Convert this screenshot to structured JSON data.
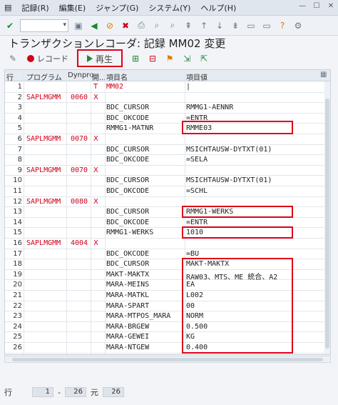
{
  "menu": {
    "items": [
      "記録(R)",
      "編集(E)",
      "ジャンプ(G)",
      "システム(Y)",
      "ヘルプ(H)"
    ]
  },
  "title": "トランザクションレコーダ: 記録 MM02 変更",
  "app_toolbar": {
    "record_label": "レコード",
    "play_label": "再生"
  },
  "grid": {
    "headers": {
      "row": "行",
      "program": "プログラム",
      "dynpro": "Dynpro",
      "start": "開...",
      "field": "項目名",
      "value": "項目値"
    },
    "rows": [
      {
        "no": "1",
        "program": "",
        "dynpro": "",
        "start": "T",
        "field": "MM02",
        "value": "|",
        "field_red": true
      },
      {
        "no": "2",
        "program": "SAPLMGMM",
        "dynpro": "0060",
        "start": "X",
        "field": "",
        "value": ""
      },
      {
        "no": "3",
        "program": "",
        "dynpro": "",
        "start": "",
        "field": "BDC_CURSOR",
        "value": "RMMG1-AENNR"
      },
      {
        "no": "4",
        "program": "",
        "dynpro": "",
        "start": "",
        "field": "BDC_OKCODE",
        "value": "=ENTR"
      },
      {
        "no": "5",
        "program": "",
        "dynpro": "",
        "start": "",
        "field": "RMMG1-MATNR",
        "value": "RMME03"
      },
      {
        "no": "6",
        "program": "SAPLMGMM",
        "dynpro": "0070",
        "start": "X",
        "field": "",
        "value": ""
      },
      {
        "no": "7",
        "program": "",
        "dynpro": "",
        "start": "",
        "field": "BDC_CURSOR",
        "value": "MSICHTAUSW-DYTXT(01)"
      },
      {
        "no": "8",
        "program": "",
        "dynpro": "",
        "start": "",
        "field": "BDC_OKCODE",
        "value": "=SELA"
      },
      {
        "no": "9",
        "program": "SAPLMGMM",
        "dynpro": "0070",
        "start": "X",
        "field": "",
        "value": ""
      },
      {
        "no": "10",
        "program": "",
        "dynpro": "",
        "start": "",
        "field": "BDC_CURSOR",
        "value": "MSICHTAUSW-DYTXT(01)"
      },
      {
        "no": "11",
        "program": "",
        "dynpro": "",
        "start": "",
        "field": "BDC_OKCODE",
        "value": "=SCHL"
      },
      {
        "no": "12",
        "program": "SAPLMGMM",
        "dynpro": "0080",
        "start": "X",
        "field": "",
        "value": ""
      },
      {
        "no": "13",
        "program": "",
        "dynpro": "",
        "start": "",
        "field": "BDC_CURSOR",
        "value": "RMMG1-WERKS"
      },
      {
        "no": "14",
        "program": "",
        "dynpro": "",
        "start": "",
        "field": "BDC_OKCODE",
        "value": "=ENTR"
      },
      {
        "no": "15",
        "program": "",
        "dynpro": "",
        "start": "",
        "field": "RMMG1-WERKS",
        "value": "1010"
      },
      {
        "no": "16",
        "program": "SAPLMGMM",
        "dynpro": "4004",
        "start": "X",
        "field": "",
        "value": ""
      },
      {
        "no": "17",
        "program": "",
        "dynpro": "",
        "start": "",
        "field": "BDC_OKCODE",
        "value": "=BU"
      },
      {
        "no": "18",
        "program": "",
        "dynpro": "",
        "start": "",
        "field": "BDC_CURSOR",
        "value": "MAKT-MAKTX"
      },
      {
        "no": "19",
        "program": "",
        "dynpro": "",
        "start": "",
        "field": "MAKT-MAKTX",
        "value": "RAW03、MTS、ME 統合、A2"
      },
      {
        "no": "20",
        "program": "",
        "dynpro": "",
        "start": "",
        "field": "MARA-MEINS",
        "value": "EA"
      },
      {
        "no": "21",
        "program": "",
        "dynpro": "",
        "start": "",
        "field": "MARA-MATKL",
        "value": "L002"
      },
      {
        "no": "22",
        "program": "",
        "dynpro": "",
        "start": "",
        "field": "MARA-SPART",
        "value": "00"
      },
      {
        "no": "23",
        "program": "",
        "dynpro": "",
        "start": "",
        "field": "MARA-MTPOS_MARA",
        "value": "NORM"
      },
      {
        "no": "24",
        "program": "",
        "dynpro": "",
        "start": "",
        "field": "MARA-BRGEW",
        "value": "0.500"
      },
      {
        "no": "25",
        "program": "",
        "dynpro": "",
        "start": "",
        "field": "MARA-GEWEI",
        "value": "KG"
      },
      {
        "no": "26",
        "program": "",
        "dynpro": "",
        "start": "",
        "field": "MARA-NTGEW",
        "value": "0.400"
      }
    ]
  },
  "footer": {
    "row_label": "行",
    "from": "1",
    "sep": "-",
    "to": "26",
    "of_label": "元",
    "total": "26"
  },
  "colors": {
    "highlight": "#e00018",
    "program_text": "#d0021b",
    "play": "#1a8a2e"
  }
}
